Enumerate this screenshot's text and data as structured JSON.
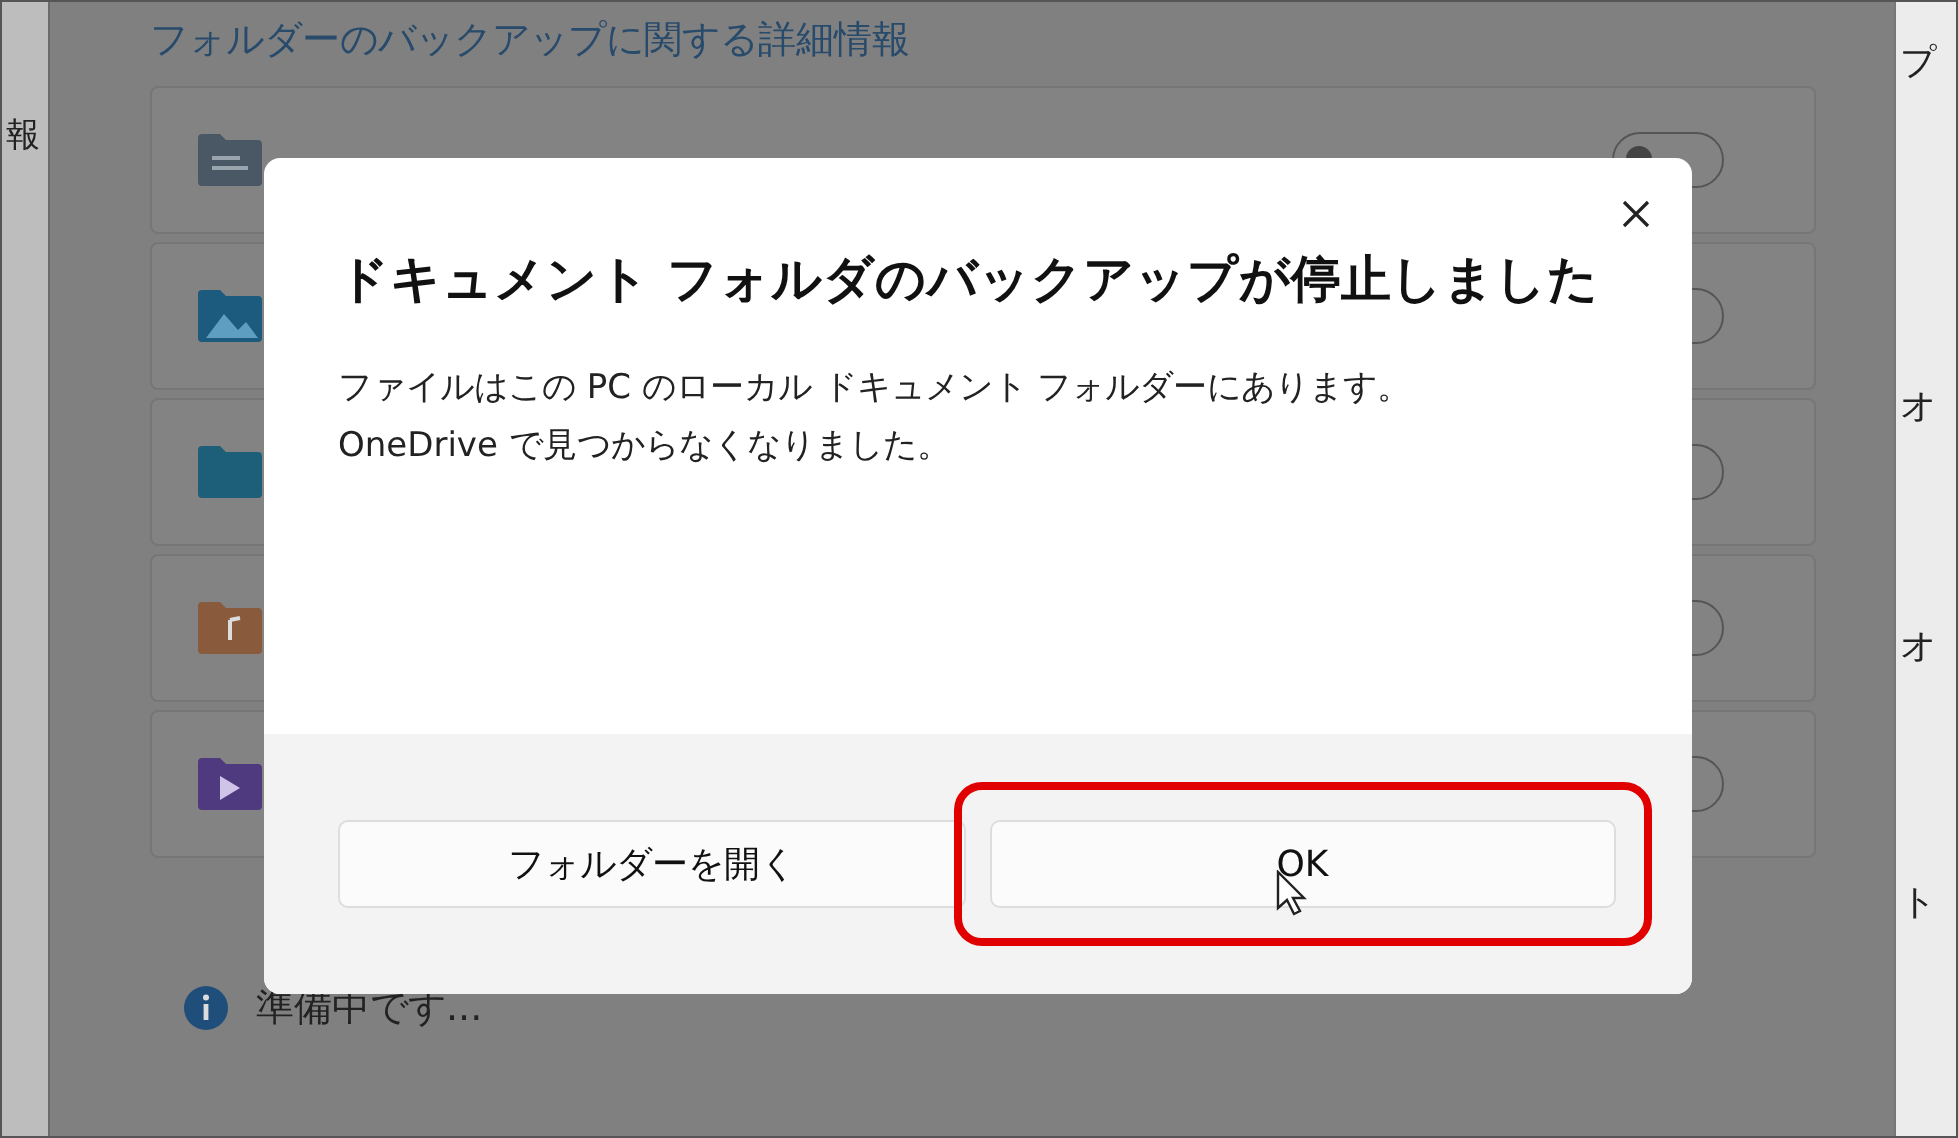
{
  "background": {
    "left_edge_text": "報",
    "heading": "フォルダーのバックアップに関する詳細情報",
    "folders": [
      {
        "kind": "documents",
        "on": false
      },
      {
        "kind": "pictures",
        "on": false
      },
      {
        "kind": "desktop",
        "on": false
      },
      {
        "kind": "music",
        "on": false
      },
      {
        "kind": "videos",
        "on": false
      }
    ],
    "right_edge_texts": [
      "プ",
      "オ",
      "オ",
      "ト"
    ],
    "status": "準備中です..."
  },
  "dialog": {
    "title": "ドキュメント フォルダのバックアップが停止しました",
    "message": "ファイルはこの PC のローカル ドキュメント フォルダーにあります。OneDrive で見つからなくなりました。",
    "buttons": [
      {
        "label": "フォルダーを開く",
        "highlighted": false,
        "hovered": false
      },
      {
        "label": "OK",
        "highlighted": true,
        "hovered": true
      }
    ]
  }
}
